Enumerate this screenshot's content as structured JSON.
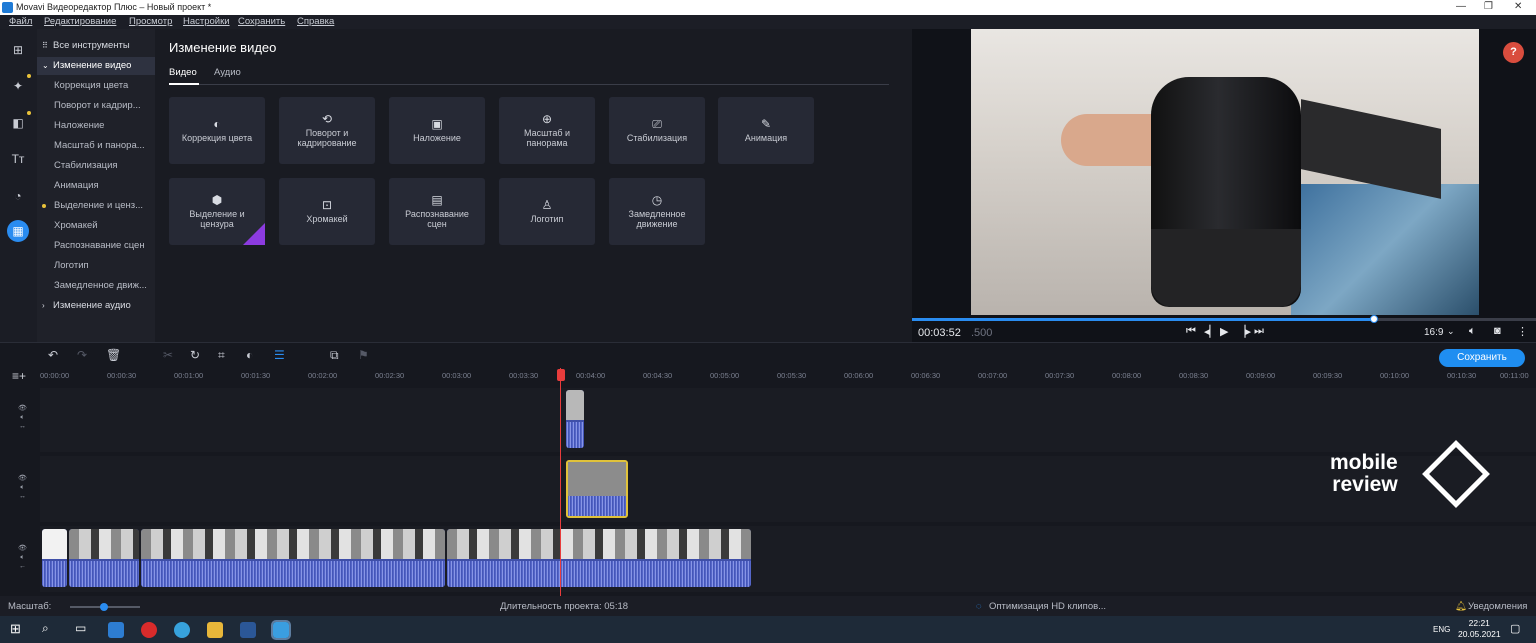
{
  "window": {
    "title": "Movavi Видеоредактор Плюс – Новый проект *"
  },
  "menu": [
    "Файл",
    "Редактирование",
    "Просмотр",
    "Настройки",
    "Сохранить",
    "Справка"
  ],
  "sidebar": {
    "all_tools": "Все инструменты",
    "items": [
      "Изменение видео",
      "Коррекция цвета",
      "Поворот и кадрир...",
      "Наложение",
      "Масштаб и панора...",
      "Стабилизация",
      "Анимация",
      "Выделение и ценз...",
      "Хромакей",
      "Распознавание сцен",
      "Логотип",
      "Замедленное движ...",
      "Изменение аудио"
    ]
  },
  "panel": {
    "title": "Изменение видео",
    "tabs": [
      "Видео",
      "Аудио"
    ],
    "tiles": [
      "Коррекция цвета",
      "Поворот и кадрирование",
      "Наложение",
      "Масштаб и панорама",
      "Стабилизация",
      "Анимация",
      "Выделение и цензура",
      "Хромакей",
      "Распознавание сцен",
      "Логотип",
      "Замедленное движение"
    ],
    "new_badge": "NEW"
  },
  "player": {
    "timecode": "00:03:52",
    "timecode_ms": ".500",
    "progress": 0.74,
    "aspect": "16:9",
    "help": "?"
  },
  "toolbar": {
    "save_label": "Сохранить"
  },
  "ruler": [
    "00:00:00",
    "00:00:30",
    "00:01:00",
    "00:01:30",
    "00:02:00",
    "00:02:30",
    "00:03:00",
    "00:03:30",
    "00:04:00",
    "00:04:30",
    "00:05:00",
    "00:05:30",
    "00:06:00",
    "00:06:30",
    "00:07:00",
    "00:07:30",
    "00:08:00",
    "00:08:30",
    "00:09:00",
    "00:09:30",
    "00:10:00",
    "00:10:30",
    "00:11:00"
  ],
  "watermark": {
    "line1": "mobile",
    "line2": "review"
  },
  "status": {
    "zoom_label": "Масштаб:",
    "duration": "Длительность проекта:  05:18",
    "optimizing": "Оптимизация HD клипов...",
    "notifications": "Уведомления"
  },
  "tray": {
    "time": "22:21",
    "date": "20.05.2021",
    "lang": "ENG"
  },
  "colors": {
    "accent": "#2a8cf0",
    "playhead": "#e83c3c",
    "selected_clip": "#e0c23a"
  }
}
